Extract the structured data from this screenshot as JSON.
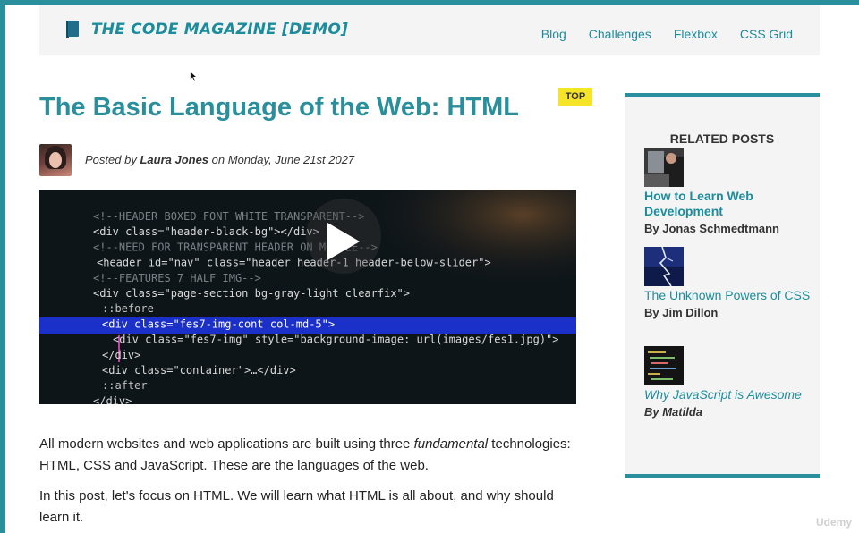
{
  "header": {
    "brand": "THE CODE MAGAZINE [DEMO]",
    "brand_icon": "book-icon",
    "nav": [
      "Blog",
      "Challenges",
      "Flexbox",
      "CSS Grid"
    ]
  },
  "post": {
    "title": "The Basic Language of the Web: HTML",
    "badge": "TOP",
    "posted_prefix": "Posted by",
    "author": "Laura Jones",
    "posted_on": "on Monday, June 21st 2027",
    "video_code_lines": [
      "<!--HEADER BOXED FONT WHITE TRANSPARENT-->",
      "<div class=\"header-black-bg\"></div>",
      "<!--NEED FOR TRANSPARENT HEADER ON MOBILE-->",
      "<header id=\"nav\" class=\"header header-1 header-below-slider\">",
      "<!--FEATURES 7 HALF IMG-->",
      "<div class=\"page-section bg-gray-light clearfix\">",
      "::before",
      "<div class=\"fes7-img-cont col-md-5\">",
      "<div class=\"fes7-img\" style=\"background-image: url(images/fes1.jpg)\">",
      "</div>",
      "<div class=\"container\">…</div>",
      "::after",
      "</div>"
    ],
    "paragraph1_a": "All modern websites and web applications are built using three ",
    "paragraph1_em": "fundamental",
    "paragraph1_b": " technologies: HTML, CSS and JavaScript. These are the languages of the web.",
    "paragraph2": "In this post, let's focus on HTML. We will learn what HTML is all about, and why should learn it."
  },
  "sidebar": {
    "title": "RELATED POSTS",
    "items": [
      {
        "title": "How to Learn Web Development",
        "author": "By Jonas Schmedtmann"
      },
      {
        "title": "The Unknown Powers of CSS",
        "author": "By Jim Dillon"
      },
      {
        "title": "Why JavaScript is Awesome",
        "author": "By Matilda"
      }
    ]
  },
  "watermark": "Udemy",
  "colors": {
    "accent": "#2a8f9c",
    "badge": "#f5e427",
    "panel": "#f4f4f5"
  }
}
